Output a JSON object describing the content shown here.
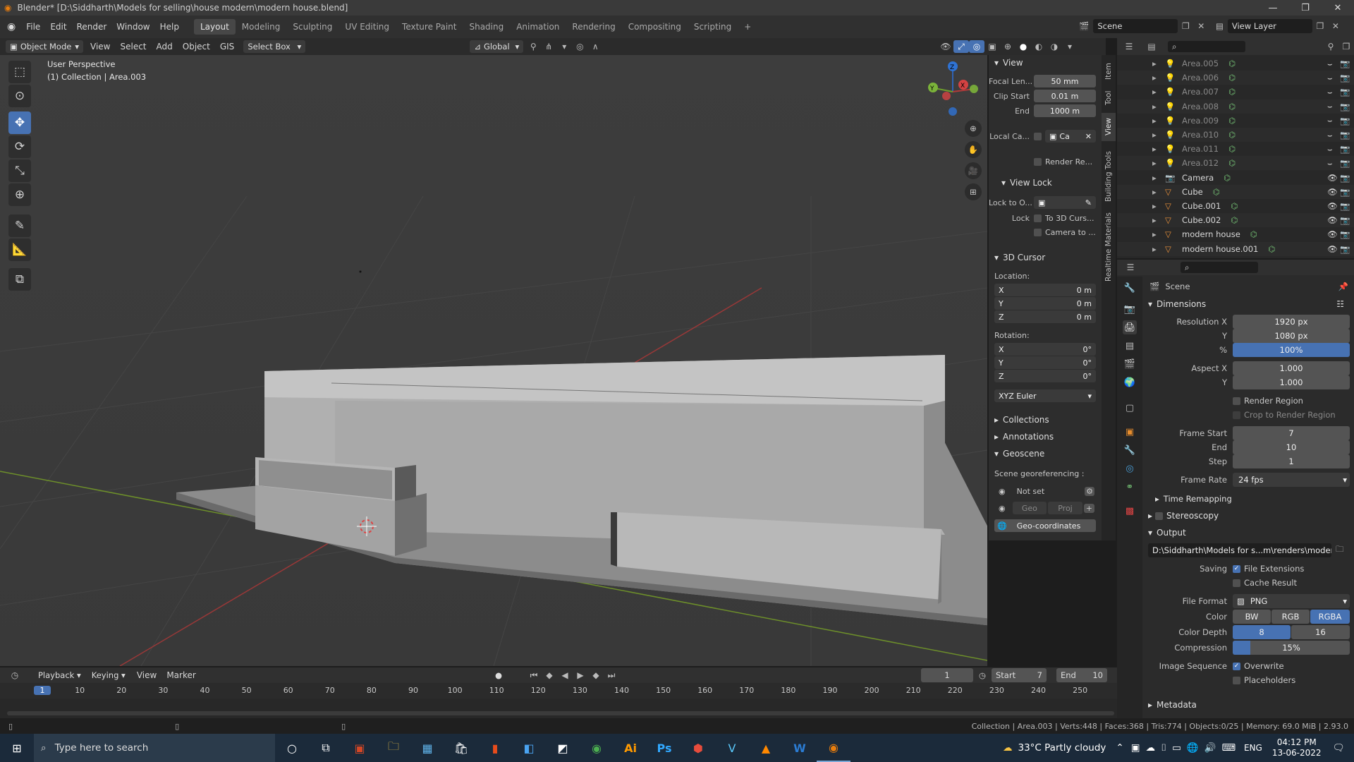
{
  "window": {
    "title": "Blender* [D:\\Siddharth\\Models for selling\\house modern\\modern house.blend]"
  },
  "menu": {
    "items": [
      "File",
      "Edit",
      "Render",
      "Window",
      "Help"
    ]
  },
  "workspaces": {
    "tabs": [
      "Layout",
      "Modeling",
      "Sculpting",
      "UV Editing",
      "Texture Paint",
      "Shading",
      "Animation",
      "Rendering",
      "Compositing",
      "Scripting"
    ],
    "active": "Layout"
  },
  "scene": {
    "label": "Scene",
    "view_layer": "View Layer"
  },
  "viewport_header": {
    "mode": "Object Mode",
    "menus": [
      "View",
      "Select",
      "Add",
      "Object",
      "GIS"
    ],
    "select_box": "Select Box",
    "transform_orientation": "Global"
  },
  "viewport": {
    "perspective": "User Perspective",
    "collection_info": "(1) Collection | Area.003"
  },
  "npanel": {
    "view_section": "View",
    "focal_length_label": "Focal Len...",
    "focal_length": "50 mm",
    "clip_start_label": "Clip Start",
    "clip_start": "0.01 m",
    "clip_end_label": "End",
    "clip_end": "1000 m",
    "local_camera_label": "Local Ca...",
    "local_camera_field": "Ca",
    "render_region": "Render Re...",
    "view_lock_section": "View Lock",
    "lock_to_object_label": "Lock to O...",
    "lock_label": "Lock",
    "lock_to_cursor": "To 3D Curs...",
    "camera_to_view": "Camera to ...",
    "cursor_section": "3D Cursor",
    "location_label": "Location:",
    "loc": [
      {
        "axis": "X",
        "value": "0 m"
      },
      {
        "axis": "Y",
        "value": "0 m"
      },
      {
        "axis": "Z",
        "value": "0 m"
      }
    ],
    "rotation_label": "Rotation:",
    "rot": [
      {
        "axis": "X",
        "value": "0°"
      },
      {
        "axis": "Y",
        "value": "0°"
      },
      {
        "axis": "Z",
        "value": "0°"
      }
    ],
    "rotation_mode": "XYZ Euler",
    "collections_section": "Collections",
    "annotations_section": "Annotations",
    "geoscene_section": "Geoscene",
    "georef_label": "Scene georeferencing :",
    "not_set": "Not set",
    "geo_btn": "Geo",
    "proj_btn": "Proj",
    "geocoords_btn": "Geo-coordinates"
  },
  "npanel_tabs": [
    "Item",
    "Tool",
    "View",
    "Building Tools",
    "Realtime Materials"
  ],
  "outliner": {
    "items": [
      {
        "name": "Area.005",
        "type": "light"
      },
      {
        "name": "Area.006",
        "type": "light"
      },
      {
        "name": "Area.007",
        "type": "light"
      },
      {
        "name": "Area.008",
        "type": "light"
      },
      {
        "name": "Area.009",
        "type": "light"
      },
      {
        "name": "Area.010",
        "type": "light"
      },
      {
        "name": "Area.011",
        "type": "light"
      },
      {
        "name": "Area.012",
        "type": "light"
      },
      {
        "name": "Camera",
        "type": "camera"
      },
      {
        "name": "Cube",
        "type": "mesh"
      },
      {
        "name": "Cube.001",
        "type": "mesh"
      },
      {
        "name": "Cube.002",
        "type": "mesh"
      },
      {
        "name": "modern house",
        "type": "mesh"
      },
      {
        "name": "modern house.001",
        "type": "mesh"
      }
    ]
  },
  "properties": {
    "context": "Scene",
    "dimensions_section": "Dimensions",
    "res_x_label": "Resolution X",
    "res_x": "1920 px",
    "res_y_label": "Y",
    "res_y": "1080 px",
    "res_pct_label": "%",
    "res_pct": "100%",
    "aspect_x_label": "Aspect X",
    "aspect_x": "1.000",
    "aspect_y_label": "Y",
    "aspect_y": "1.000",
    "render_region": "Render Region",
    "crop_region": "Crop to Render Region",
    "frame_start_label": "Frame Start",
    "frame_start": "7",
    "frame_end_label": "End",
    "frame_end": "10",
    "frame_step_label": "Step",
    "frame_step": "1",
    "frame_rate_label": "Frame Rate",
    "frame_rate": "24 fps",
    "time_remapping": "Time Remapping",
    "stereoscopy": "Stereoscopy",
    "output_section": "Output",
    "output_path": "D:\\Siddharth\\Models for s...m\\renders\\modern house",
    "saving_label": "Saving",
    "file_extensions": "File Extensions",
    "cache_result": "Cache Result",
    "file_format_label": "File Format",
    "file_format": "PNG",
    "color_label": "Color",
    "color_opts": [
      "BW",
      "RGB",
      "RGBA"
    ],
    "color_active": "RGBA",
    "color_depth_label": "Color Depth",
    "depth_opts": [
      "8",
      "16"
    ],
    "compression_label": "Compression",
    "compression": "15%",
    "compression_fraction": 0.15,
    "image_seq_label": "Image Sequence",
    "overwrite": "Overwrite",
    "placeholders": "Placeholders",
    "metadata_section": "Metadata"
  },
  "timeline": {
    "menus": [
      "Playback",
      "Keying",
      "View",
      "Marker"
    ],
    "current_frame": "1",
    "start_label": "Start",
    "start": "7",
    "end_label": "End",
    "end": "10",
    "ticks": [
      "1",
      "10",
      "20",
      "30",
      "40",
      "50",
      "60",
      "70",
      "80",
      "90",
      "100",
      "110",
      "120",
      "130",
      "140",
      "150",
      "160",
      "170",
      "180",
      "190",
      "200",
      "210",
      "220",
      "230",
      "240",
      "250"
    ]
  },
  "status": {
    "text": "Collection | Area.003 | Verts:448 | Faces:368 | Tris:774 | Objects:0/25 | Memory: 69.0 MiB | 2.93.0"
  },
  "taskbar": {
    "search_placeholder": "Type here to search",
    "weather": "33°C  Partly cloudy",
    "lang": "ENG",
    "time": "04:12 PM",
    "date": "13-06-2022"
  }
}
